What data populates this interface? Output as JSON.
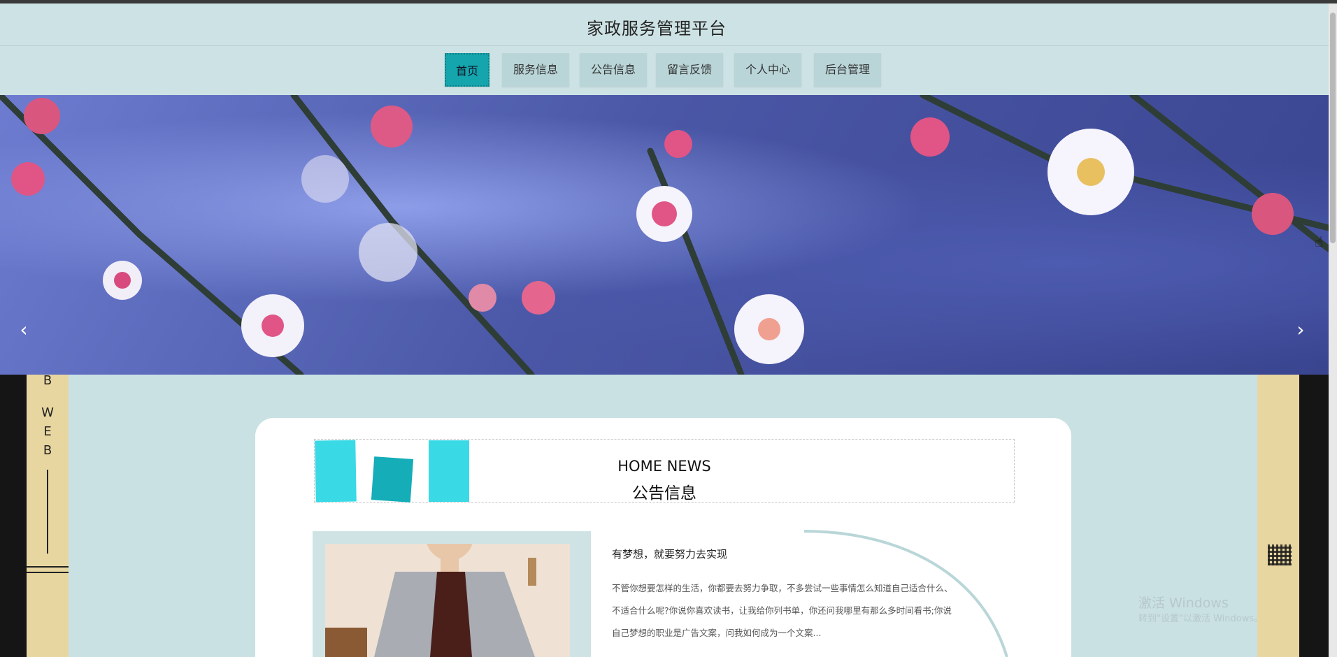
{
  "header": {
    "title": "家政服务管理平台"
  },
  "nav": {
    "items": [
      {
        "label": "首页",
        "active": true
      },
      {
        "label": "服务信息",
        "active": false
      },
      {
        "label": "公告信息",
        "active": false
      },
      {
        "label": "留言反馈",
        "active": false
      },
      {
        "label": "个人中心",
        "active": false
      },
      {
        "label": "后台管理",
        "active": false
      }
    ]
  },
  "banner": {
    "prev_icon": "chevron-left-icon",
    "next_icon": "chevron-right-icon",
    "prev_glyph": "‹",
    "next_glyph": "›"
  },
  "side_deco": {
    "letters": [
      "B",
      "W",
      "E",
      "B"
    ]
  },
  "news": {
    "heading_en": "HOME NEWS",
    "heading_cn": "公告信息",
    "item": {
      "title": "有梦想，就要努力去实现",
      "body": "不管你想要怎样的生活，你都要去努力争取，不多尝试一些事情怎么知道自己适合什么、不适合什么呢?你说你喜欢读书，让我给你列书单，你还问我哪里有那么多时间看书;你说自己梦想的职业是广告文案，问我如何成为一个文案..."
    }
  },
  "watermark": {
    "line1": "激活 Windows",
    "line2": "转到\"设置\"以激活 Windows。"
  },
  "colors": {
    "accent": "#14a5ad",
    "nav_bg": "#cde2e4",
    "deco_cyan": "#39d9e6",
    "side_gold": "#e8d6a0"
  }
}
